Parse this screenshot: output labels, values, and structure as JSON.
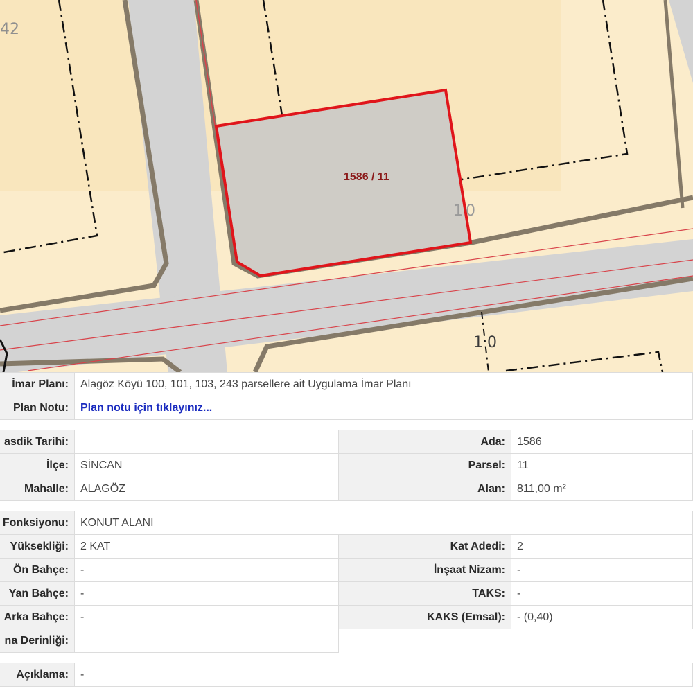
{
  "map": {
    "edge_label_top": "42",
    "parcel_label": "1586 / 11",
    "parcel_no_a": "10",
    "parcel_no_b": "10",
    "colors": {
      "block_fill": "#fbeccb",
      "road_fill": "#d2d2d2",
      "parcel_border": "#e0151b",
      "selected_fill": "#cfccc6"
    }
  },
  "plan": {
    "plan_name_label": "İmar Planı:",
    "plan_name_value": "Alagöz Köyü 100, 101, 103, 243 parsellere ait Uygulama İmar Planı",
    "plan_note_label": "Plan Notu:",
    "plan_note_link": "Plan notu için tıklayınız..."
  },
  "parcel": {
    "approval_date_label": "asdik Tarihi:",
    "approval_date_value": "",
    "ada_label": "Ada:",
    "ada_value": "1586",
    "district_label": "İlçe:",
    "district_value": "SİNCAN",
    "parsel_label": "Parsel:",
    "parsel_value": "11",
    "neighborhood_label": "Mahalle:",
    "neighborhood_value": "ALAGÖZ",
    "area_label": "Alan:",
    "area_value": "811,00 m²"
  },
  "zoning": {
    "function_label": "Fonksiyonu:",
    "function_value": "KONUT ALANI",
    "height_label": "Yüksekliği:",
    "height_value": "2 KAT",
    "floor_count_label": "Kat Adedi:",
    "floor_count_value": "2",
    "front_yard_label": "Ön Bahçe:",
    "front_yard_value": "-",
    "build_order_label": "İnşaat Nizam:",
    "build_order_value": "-",
    "side_yard_label": "Yan Bahçe:",
    "side_yard_value": "-",
    "taks_label": "TAKS:",
    "taks_value": "-",
    "rear_yard_label": "Arka Bahçe:",
    "rear_yard_value": "-",
    "kaks_label": "KAKS (Emsal):",
    "kaks_value": "- (0,40)",
    "depth_label": "na Derinliği:",
    "depth_value": ""
  },
  "notes": {
    "desc_label": "Açıklama:",
    "desc_value": "-"
  }
}
